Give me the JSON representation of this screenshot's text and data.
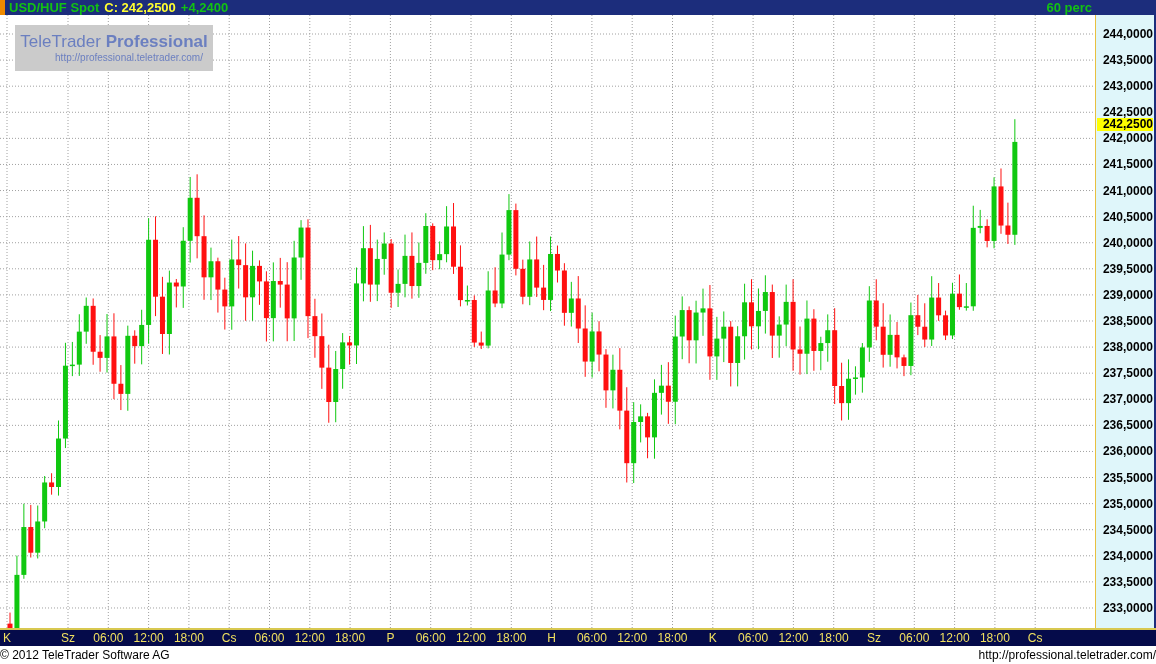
{
  "header": {
    "symbol": "USD/HUF Spot",
    "close": "C: 242,2500",
    "change": "+4,2400",
    "interval": "60 perc"
  },
  "watermark": {
    "title": "TeleTrader **Professional**",
    "url": "http://professional.teletrader.com/"
  },
  "price_axis": {
    "ticks": [
      "244,0000",
      "243,5000",
      "243,0000",
      "242,5000",
      "242,0000",
      "241,5000",
      "241,0000",
      "240,5000",
      "240,0000",
      "239,5000",
      "239,0000",
      "238,5000",
      "238,0000",
      "237,5000",
      "237,0000",
      "236,5000",
      "236,0000",
      "235,5000",
      "235,0000",
      "234,5000",
      "234,0000",
      "233,5000",
      "233,0000"
    ],
    "last_price": "242,2500"
  },
  "time_axis": {
    "labels": [
      "K",
      "Sz",
      "06:00",
      "12:00",
      "18:00",
      "Cs",
      "06:00",
      "12:00",
      "18:00",
      "P",
      "06:00",
      "12:00",
      "18:00",
      "H",
      "06:00",
      "12:00",
      "18:00",
      "K",
      "06:00",
      "12:00",
      "18:00",
      "Sz",
      "06:00",
      "12:00",
      "18:00",
      "Cs"
    ]
  },
  "footer": {
    "copyright": "© 2012 TeleTrader Software AG",
    "url": "http://professional.teletrader.com/"
  }
}
